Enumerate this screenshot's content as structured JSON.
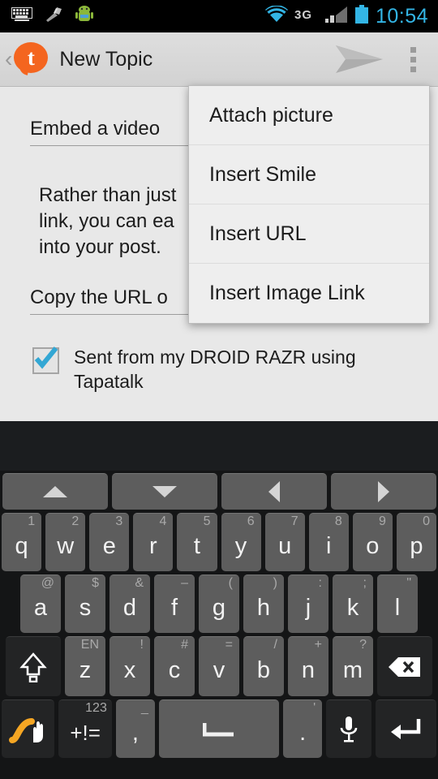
{
  "status_bar": {
    "icons": [
      "keyboard-icon",
      "broom-icon",
      "android-robot-icon"
    ],
    "wifi": "wifi-icon",
    "network": "3G",
    "signal": "signal-icon",
    "battery": "battery-icon",
    "time": "10:54",
    "accent_color": "#33b5e5"
  },
  "action_bar": {
    "back": "‹",
    "logo": "tapatalk-logo",
    "title": "New Topic",
    "send_label": "send-icon",
    "overflow_label": "overflow-menu-icon"
  },
  "content": {
    "subject_value": "Embed a video",
    "body_value": "Rather than just\nlink, you can ea\ninto your post.",
    "url_value": "Copy the URL o",
    "signature_text": "Sent from my DROID RAZR using Tapatalk",
    "signature_checked": true,
    "checkbox_color": "#33a7d4"
  },
  "dropdown": {
    "items": [
      {
        "label": "Attach picture"
      },
      {
        "label": "Insert Smile"
      },
      {
        "label": "Insert URL"
      },
      {
        "label": "Insert Image Link"
      }
    ]
  },
  "keyboard": {
    "nav_keys": [
      {
        "name": "arrow-up",
        "glyph": "▲"
      },
      {
        "name": "arrow-down",
        "glyph": "▼"
      },
      {
        "name": "arrow-left",
        "glyph": "◀"
      },
      {
        "name": "arrow-right",
        "glyph": "▶"
      }
    ],
    "row1": [
      {
        "key": "q",
        "hint": "1"
      },
      {
        "key": "w",
        "hint": "2"
      },
      {
        "key": "e",
        "hint": "3"
      },
      {
        "key": "r",
        "hint": "4"
      },
      {
        "key": "t",
        "hint": "5"
      },
      {
        "key": "y",
        "hint": "6"
      },
      {
        "key": "u",
        "hint": "7"
      },
      {
        "key": "i",
        "hint": "8"
      },
      {
        "key": "o",
        "hint": "9"
      },
      {
        "key": "p",
        "hint": "0"
      }
    ],
    "row2": [
      {
        "key": "a",
        "hint": "@"
      },
      {
        "key": "s",
        "hint": "$"
      },
      {
        "key": "d",
        "hint": "&"
      },
      {
        "key": "f",
        "hint": "–"
      },
      {
        "key": "g",
        "hint": "("
      },
      {
        "key": "h",
        "hint": ")"
      },
      {
        "key": "j",
        "hint": ":"
      },
      {
        "key": "k",
        "hint": ";"
      },
      {
        "key": "l",
        "hint": "\""
      }
    ],
    "row3": {
      "shift": "shift-icon",
      "keys": [
        {
          "key": "z",
          "hint": "EN"
        },
        {
          "key": "x",
          "hint": "!"
        },
        {
          "key": "c",
          "hint": "#"
        },
        {
          "key": "v",
          "hint": "="
        },
        {
          "key": "b",
          "hint": "/"
        },
        {
          "key": "n",
          "hint": "+"
        },
        {
          "key": "m",
          "hint": "?"
        }
      ],
      "backspace": "backspace-icon"
    },
    "row4": {
      "swype": "swype-icon",
      "symbols_hint": "123",
      "symbols_label": "+!=",
      "comma_hint": "_",
      "comma_label": ",",
      "space_label": "space-key",
      "period_hint": "'",
      "period_label": ".",
      "mic_label": "microphone-icon",
      "enter_label": "enter-icon"
    }
  }
}
